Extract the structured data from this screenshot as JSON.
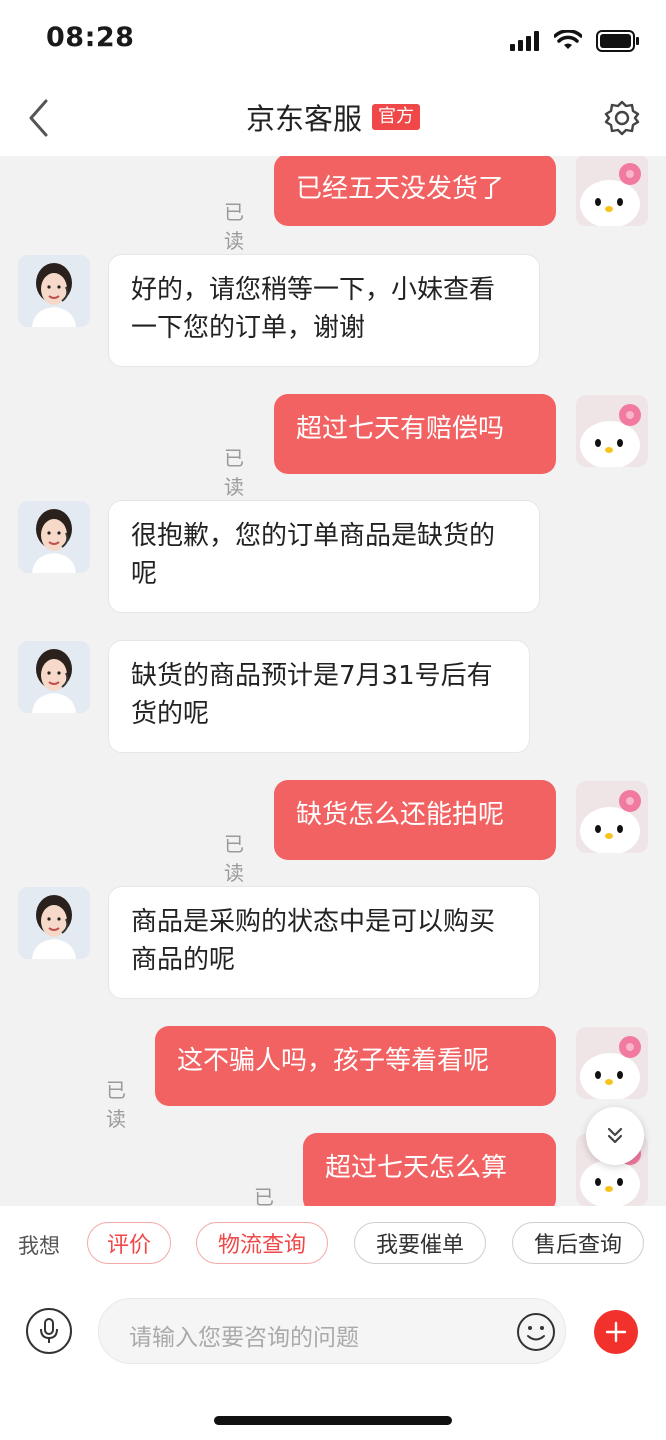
{
  "status_bar": {
    "time": "08:28"
  },
  "header": {
    "title": "京东客服",
    "badge": "官方"
  },
  "messages": [
    {
      "sender": "user",
      "text": "已经五天没发货了",
      "read": "已读"
    },
    {
      "sender": "agent",
      "text": "好的，请您稍等一下，小妹查看一下您的订单，谢谢"
    },
    {
      "sender": "user",
      "text": "超过七天有赔偿吗",
      "read": "已读"
    },
    {
      "sender": "agent",
      "text": "很抱歉，您的订单商品是缺货的呢"
    },
    {
      "sender": "agent",
      "text": "缺货的商品预计是7月31号后有货的呢"
    },
    {
      "sender": "user",
      "text": "缺货怎么还能拍呢",
      "read": "已读"
    },
    {
      "sender": "agent",
      "text": "商品是采购的状态中是可以购买商品的呢"
    },
    {
      "sender": "user",
      "text": "这不骗人吗，孩子等着看呢",
      "read": "已读"
    },
    {
      "sender": "user",
      "text": "超过七天怎么算",
      "read": "已读"
    }
  ],
  "quick_actions": {
    "prefix": "我想",
    "chips": [
      {
        "label": "评价",
        "style": "red"
      },
      {
        "label": "物流查询",
        "style": "red"
      },
      {
        "label": "我要催单",
        "style": "gray"
      },
      {
        "label": "售后查询",
        "style": "gray"
      }
    ]
  },
  "input": {
    "placeholder": "请输入您要咨询的问题"
  },
  "icons": {
    "back": "chevron-left-icon",
    "settings": "gear-icon",
    "mic": "microphone-icon",
    "emoji": "smiley-icon",
    "plus": "plus-icon",
    "scroll_down": "double-chevron-down-icon"
  },
  "colors": {
    "accent": "#f26262",
    "badge": "#f04848",
    "plus_button": "#f2302c",
    "background": "#f2f2f2"
  }
}
